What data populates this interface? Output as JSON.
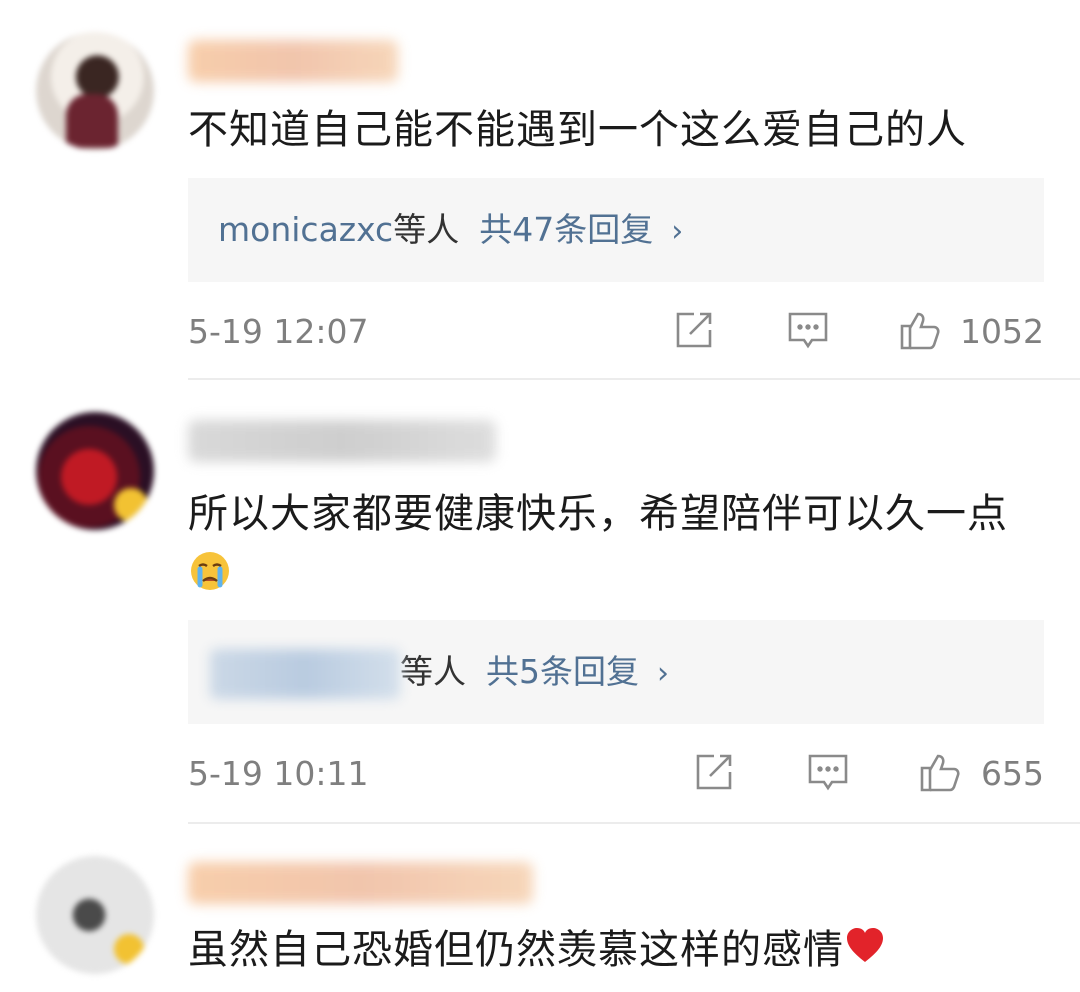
{
  "comments": [
    {
      "username": "",
      "text": "不知道自己能不能遇到一个这么爱自己的人",
      "replies": {
        "name": "monicazxc",
        "etal": "等人",
        "count": "共47条回复",
        "chevron": "›"
      },
      "time": "5-19 12:07",
      "likes": "1052"
    },
    {
      "username": "",
      "text": "所以大家都要健康快乐，希望陪伴可以久一点",
      "emoji": "crying-face",
      "replies": {
        "name": "",
        "etal": "等人",
        "count": "共5条回复",
        "chevron": "›"
      },
      "time": "5-19 10:11",
      "likes": "655"
    },
    {
      "username": "",
      "text": "虽然自己恐婚但仍然羡慕这样的感情",
      "emoji": "red-heart"
    }
  ],
  "icons": {
    "share": "share-icon",
    "comment": "comment-icon",
    "like": "thumbs-up-icon"
  },
  "colors": {
    "link": "#517193",
    "meta": "#7f7f7f",
    "reply_bg": "#f6f6f6"
  }
}
